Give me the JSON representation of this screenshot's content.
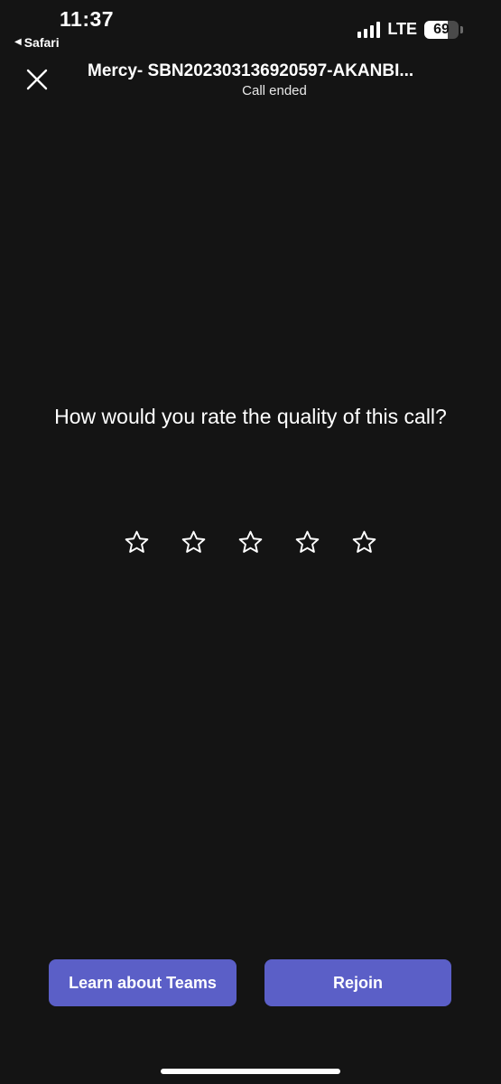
{
  "status_bar": {
    "time": "11:37",
    "back_app": "Safari",
    "network": "LTE",
    "battery_percent": "69",
    "battery_level": 0.69,
    "signal_bars": 4
  },
  "header": {
    "close_icon": "close-icon",
    "title": "Mercy- SBN202303136920597-AKANBI...",
    "subtitle": "Call ended"
  },
  "rating": {
    "question": "How would you rate the quality of this call?",
    "stars_total": 5,
    "stars_selected": 0,
    "star_icon": "star-outline-icon"
  },
  "actions": {
    "learn_label": "Learn about Teams",
    "rejoin_label": "Rejoin"
  },
  "colors": {
    "background": "#141414",
    "accent": "#5b5fc7",
    "text": "#ffffff"
  }
}
